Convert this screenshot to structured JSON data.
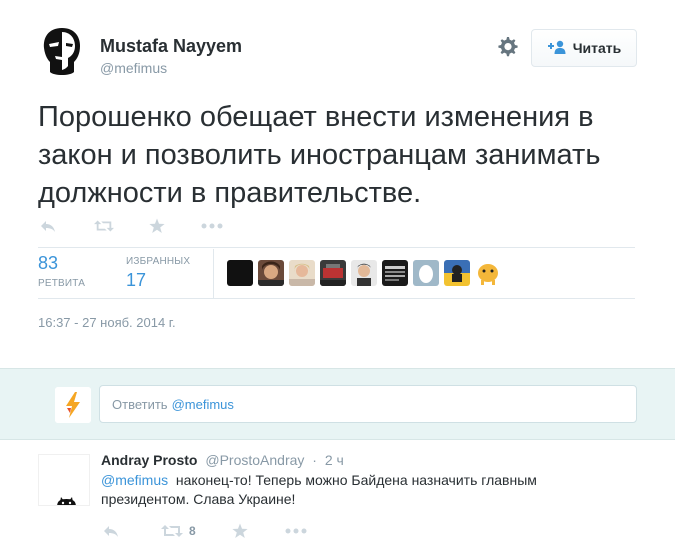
{
  "tweet": {
    "author_name": "Mustafa Nayyem",
    "author_handle": "@mefimus",
    "follow_label": "Читать",
    "text": "Порошенко обещает внести изменения в закон и позволить иностранцам занимать должности в правительстве.",
    "retweets_count": "83",
    "retweets_label": "РЕТВИТА",
    "favorites_label": "ИЗБРАННЫХ",
    "favorites_count": "17",
    "timestamp": "16:37 - 27 нояб. 2014 г.",
    "icons": [
      "reply-icon",
      "retweet-icon",
      "favorite-icon",
      "more-icon",
      "gear-icon",
      "follow-user-icon"
    ]
  },
  "reply_box": {
    "prefix": "Ответить",
    "mention": "@mefimus"
  },
  "reply": {
    "author_name": "Andray Prosto",
    "author_handle": "@ProstoAndray",
    "separator": "·",
    "time": "2 ч",
    "mention": "@mefimus",
    "text": "наконец-то! Теперь можно Байдена назначить главным президентом. Слава Украине!",
    "retweet_count": "8"
  },
  "colors": {
    "link": "#3b94d9",
    "muted": "#8899a6",
    "text": "#292f33",
    "reply_bg": "#e8f4f4"
  }
}
